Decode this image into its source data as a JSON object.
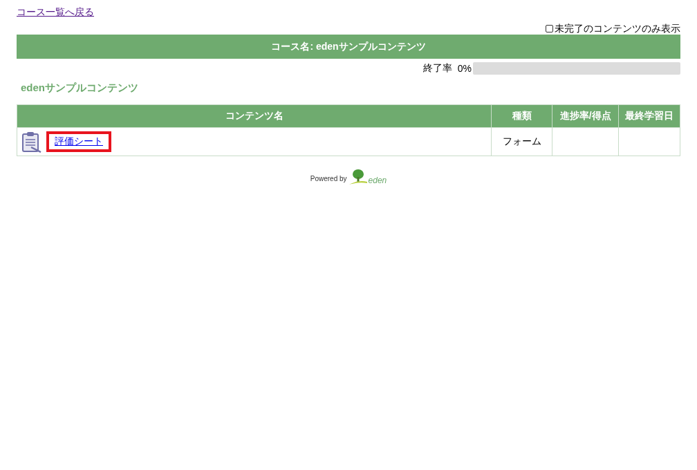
{
  "back_link": "コース一覧へ戻る",
  "filter": {
    "label": "未完了のコンテンツのみ表示",
    "checked": false
  },
  "course_title": "コース名: edenサンプルコンテンツ",
  "completion": {
    "label": "終了率",
    "reading": "0%",
    "level": 0
  },
  "section_title": "edenサンプルコンテンツ",
  "table": {
    "columns": [
      "コンテンツ名",
      "種類",
      "進捗率/得点",
      "最終学習日"
    ],
    "rows": [
      {
        "name": "評価シート",
        "highlighted": true,
        "type": "フォーム"
      }
    ]
  },
  "footer": {
    "text": "Powered by",
    "logo_text": "eden"
  }
}
